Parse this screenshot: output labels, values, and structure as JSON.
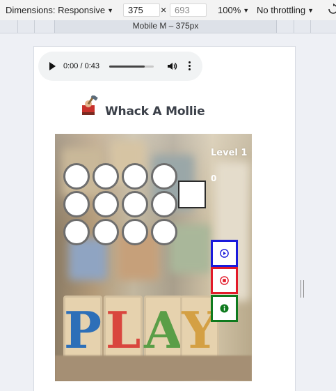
{
  "devtools": {
    "dimensions_label": "Dimensions: Responsive",
    "width_value": "375",
    "height_placeholder": "693",
    "times_sign": "×",
    "zoom": "100%",
    "throttling": "No throttling",
    "media_bar_label": "Mobile M – 375px"
  },
  "audio": {
    "time": "0:00 / 0:43",
    "progress_fraction": 0.8
  },
  "game": {
    "title": "Whack A Mollie",
    "level": "Level 1",
    "score": "0",
    "board_letters": [
      "P",
      "L",
      "A",
      "Y"
    ],
    "buttons": {
      "play": {
        "icon": "play-circle-icon",
        "color": "#1a1adb"
      },
      "stop": {
        "icon": "stop-circle-icon",
        "color": "#e21a2a"
      },
      "info": {
        "icon": "info-circle-icon",
        "color": "#0f7a1e"
      }
    }
  }
}
